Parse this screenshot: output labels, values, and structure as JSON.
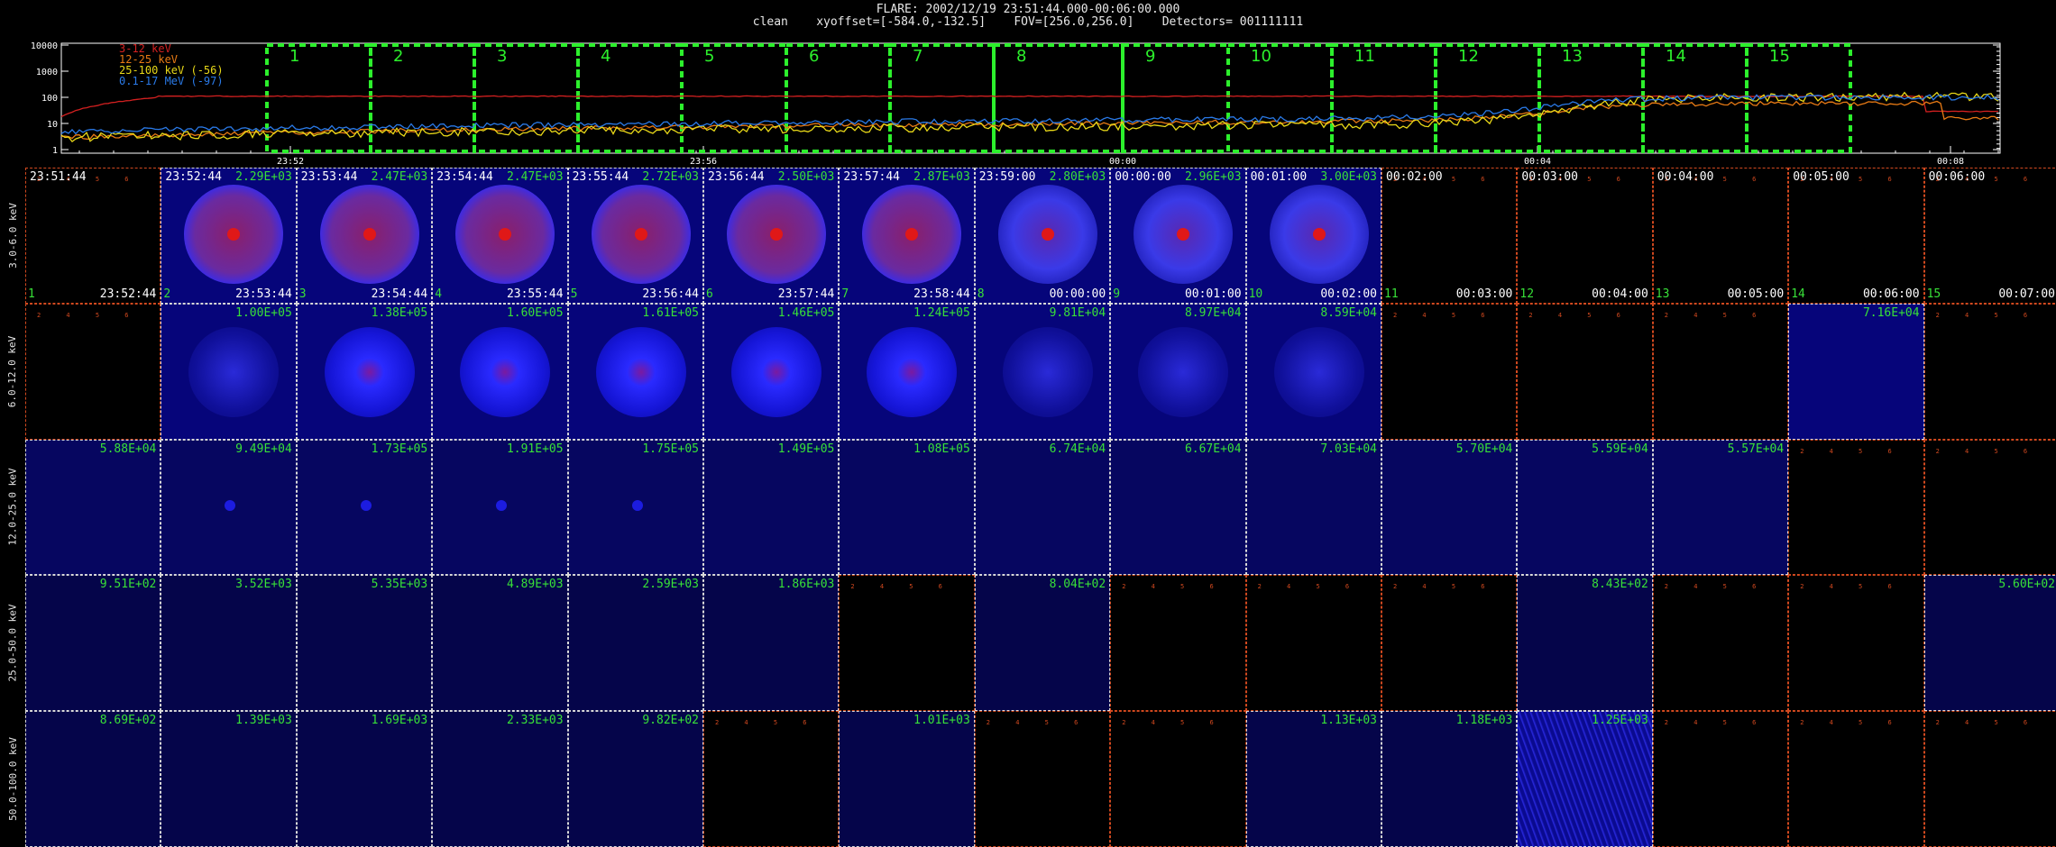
{
  "header": {
    "line1": "FLARE: 2002/12/19 23:51:44.000-00:06:00.000",
    "line2": "clean    xyoffset=[-584.0,-132.5]    FOV=[256.0,256.0]    Detectors= 001111111"
  },
  "lightcurve": {
    "y_ticks": [
      "10000",
      "1000",
      "100",
      "10",
      "1"
    ],
    "x_ticks": [
      "23:52",
      "23:56",
      "00:00",
      "00:04",
      "00:08"
    ],
    "legend": [
      {
        "label": "3-12 keV",
        "color": "#d42020"
      },
      {
        "label": "12-25 keV",
        "color": "#e87a14"
      },
      {
        "label": "25-100 keV (-56)",
        "color": "#e8d818"
      },
      {
        "label": "0.1-17 MeV (-97)",
        "color": "#2a7ae8"
      }
    ],
    "intervals": [
      "1",
      "2",
      "3",
      "4",
      "5",
      "6",
      "7",
      "8",
      "9",
      "10",
      "11",
      "12",
      "13",
      "14",
      "15"
    ],
    "interval_color": "#2cf02c"
  },
  "energy_bands": [
    "3.0-6.0 keV",
    "6.0-12.0 keV",
    "12.0-25.0 keV",
    "25.0-50.0 keV",
    "50.0-100.0 keV"
  ],
  "start_times": [
    "23:51:44",
    "23:52:44",
    "23:53:44",
    "23:54:44",
    "23:55:44",
    "23:56:44",
    "23:57:44",
    "23:59:00",
    "00:00:00",
    "00:01:00",
    "00:02:00",
    "00:03:00",
    "00:04:00",
    "00:05:00",
    "00:06:00"
  ],
  "end_times": [
    "23:52:44",
    "23:53:44",
    "23:54:44",
    "23:55:44",
    "23:56:44",
    "23:57:44",
    "23:58:44",
    "00:00:00",
    "00:01:00",
    "00:02:00",
    "00:03:00",
    "00:04:00",
    "00:05:00",
    "00:06:00",
    "00:07:00"
  ],
  "rows": [
    [
      "",
      "2.29E+03",
      "2.47E+03",
      "2.47E+03",
      "2.72E+03",
      "2.50E+03",
      "2.87E+03",
      "2.80E+03",
      "2.96E+03",
      "3.00E+03",
      "",
      "",
      "",
      "",
      ""
    ],
    [
      "",
      "1.00E+05",
      "1.38E+05",
      "1.60E+05",
      "1.61E+05",
      "1.46E+05",
      "1.24E+05",
      "9.81E+04",
      "8.97E+04",
      "8.59E+04",
      "",
      "",
      "",
      "7.16E+04",
      ""
    ],
    [
      "5.88E+04",
      "9.49E+04",
      "1.73E+05",
      "1.91E+05",
      "1.75E+05",
      "1.49E+05",
      "1.08E+05",
      "6.74E+04",
      "6.67E+04",
      "7.03E+04",
      "5.70E+04",
      "5.59E+04",
      "5.57E+04",
      "",
      ""
    ],
    [
      "9.51E+02",
      "3.52E+03",
      "5.35E+03",
      "4.89E+03",
      "2.59E+03",
      "1.86E+03",
      "",
      "8.04E+02",
      "",
      "",
      "",
      "8.43E+02",
      "",
      "",
      "5.60E+02"
    ],
    [
      "8.69E+02",
      "1.39E+03",
      "1.69E+03",
      "2.33E+03",
      "9.82E+02",
      "",
      "1.01E+03",
      "",
      "",
      "1.13E+03",
      "1.18E+03",
      "1.25E+03",
      "",
      "",
      ""
    ]
  ]
}
